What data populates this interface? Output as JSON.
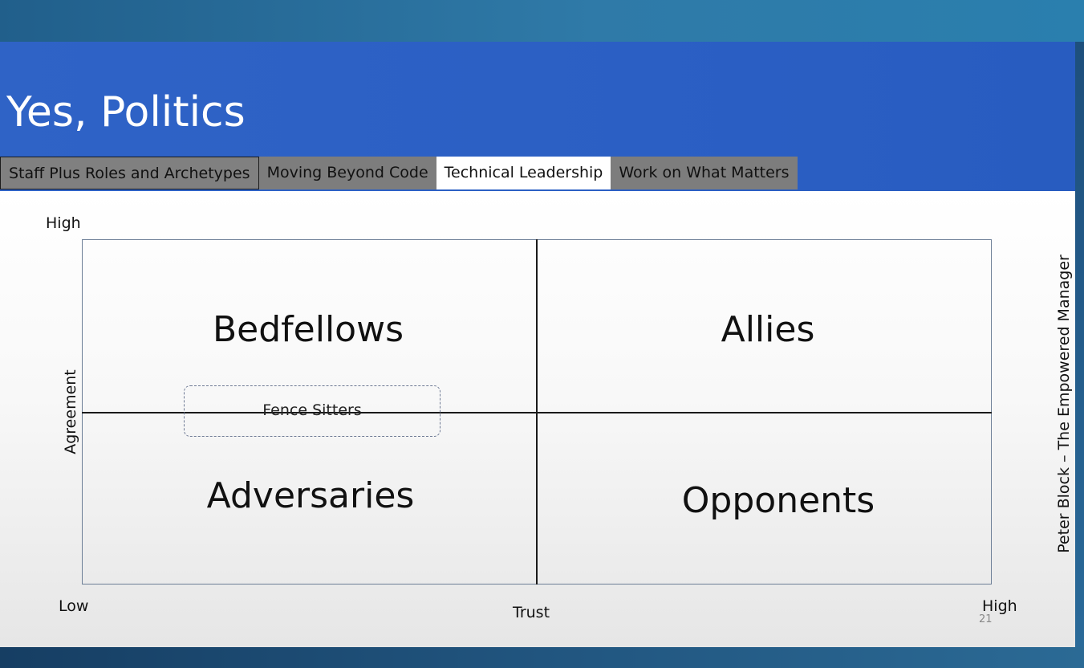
{
  "slide": {
    "title": "Yes, Politics",
    "page_number": "21",
    "tabs": [
      {
        "label": "Staff Plus Roles and Archetypes",
        "active": false
      },
      {
        "label": "Moving Beyond Code",
        "active": false
      },
      {
        "label": "Technical Leadership",
        "active": true
      },
      {
        "label": "Work on What Matters",
        "active": false
      }
    ]
  },
  "diagram": {
    "y_axis_label": "Agreement",
    "y_axis_high": "High",
    "x_axis_label": "Trust",
    "x_axis_low": "Low",
    "x_axis_high": "High",
    "quadrants": {
      "top_left": "Bedfellows",
      "top_right": "Allies",
      "bottom_left": "Adversaries",
      "bottom_right": "Opponents"
    },
    "fence_label": "Fence Sitters",
    "source": "Peter Block – The Empowered Manager"
  },
  "colors": {
    "header_blue": "#2b5fc4",
    "tab_gray": "#7d7d7d",
    "tab_active": "#ffffff",
    "background_teal": "#2b78a6"
  }
}
